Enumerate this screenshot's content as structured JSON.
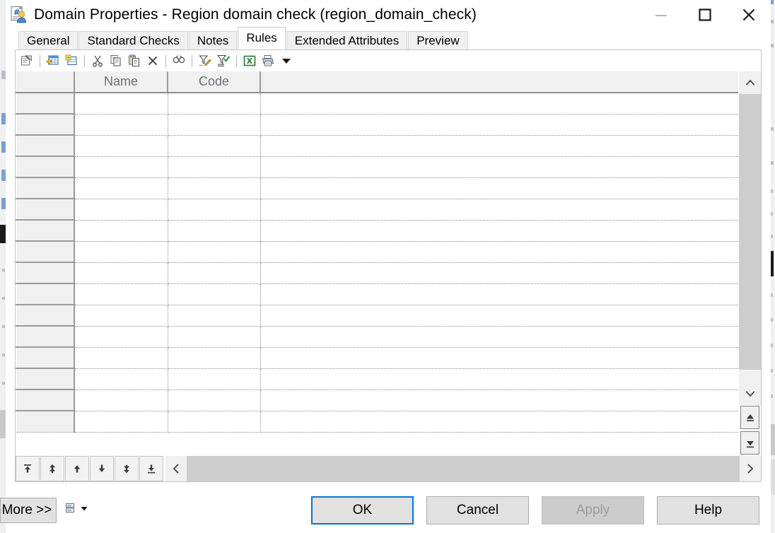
{
  "window": {
    "title": "Domain Properties - Region domain check (region_domain_check)",
    "icon": "domain-properties-icon",
    "controls": {
      "minimize": "minimize-icon",
      "maximize": "maximize-icon",
      "close": "close-icon"
    }
  },
  "tabs": [
    {
      "label": "General",
      "active": false
    },
    {
      "label": "Standard Checks",
      "active": false
    },
    {
      "label": "Notes",
      "active": false
    },
    {
      "label": "Rules",
      "active": true
    },
    {
      "label": "Extended Attributes",
      "active": false
    },
    {
      "label": "Preview",
      "active": false
    }
  ],
  "grid_toolbar": [
    {
      "name": "properties-icon",
      "tooltip": "Properties"
    },
    {
      "name": "separator",
      "tooltip": ""
    },
    {
      "name": "add-row-icon",
      "tooltip": "Add a Row"
    },
    {
      "name": "insert-row-icon",
      "tooltip": "Insert a Row"
    },
    {
      "name": "separator",
      "tooltip": ""
    },
    {
      "name": "cut-icon",
      "tooltip": "Cut"
    },
    {
      "name": "copy-icon",
      "tooltip": "Copy"
    },
    {
      "name": "paste-icon",
      "tooltip": "Paste"
    },
    {
      "name": "delete-icon",
      "tooltip": "Delete"
    },
    {
      "name": "separator",
      "tooltip": ""
    },
    {
      "name": "find-icon",
      "tooltip": "Find"
    },
    {
      "name": "separator",
      "tooltip": ""
    },
    {
      "name": "customize-filter-icon",
      "tooltip": "Customize Filter"
    },
    {
      "name": "apply-filter-icon",
      "tooltip": "Apply Filter"
    },
    {
      "name": "separator",
      "tooltip": ""
    },
    {
      "name": "excel-export-icon",
      "tooltip": "Export to Excel"
    },
    {
      "name": "print-icon",
      "tooltip": "Print"
    },
    {
      "name": "dropdown-arrow-icon",
      "tooltip": "More"
    }
  ],
  "grid": {
    "columns": [
      {
        "key": "sel",
        "label": ""
      },
      {
        "key": "name",
        "label": "Name"
      },
      {
        "key": "code",
        "label": "Code"
      },
      {
        "key": "rest",
        "label": ""
      }
    ],
    "rows": [
      {
        "sel": "",
        "name": "",
        "code": "",
        "rest": ""
      },
      {
        "sel": "",
        "name": "",
        "code": "",
        "rest": ""
      },
      {
        "sel": "",
        "name": "",
        "code": "",
        "rest": ""
      },
      {
        "sel": "",
        "name": "",
        "code": "",
        "rest": ""
      },
      {
        "sel": "",
        "name": "",
        "code": "",
        "rest": ""
      },
      {
        "sel": "",
        "name": "",
        "code": "",
        "rest": ""
      },
      {
        "sel": "",
        "name": "",
        "code": "",
        "rest": ""
      },
      {
        "sel": "",
        "name": "",
        "code": "",
        "rest": ""
      },
      {
        "sel": "",
        "name": "",
        "code": "",
        "rest": ""
      },
      {
        "sel": "",
        "name": "",
        "code": "",
        "rest": ""
      },
      {
        "sel": "",
        "name": "",
        "code": "",
        "rest": ""
      },
      {
        "sel": "",
        "name": "",
        "code": "",
        "rest": ""
      },
      {
        "sel": "",
        "name": "",
        "code": "",
        "rest": ""
      },
      {
        "sel": "",
        "name": "",
        "code": "",
        "rest": ""
      },
      {
        "sel": "",
        "name": "",
        "code": "",
        "rest": ""
      },
      {
        "sel": "",
        "name": "",
        "code": "",
        "rest": ""
      }
    ],
    "row_count": 16,
    "empty": true
  },
  "vertical_scrollbar": {
    "up_button": "scroll-up-icon",
    "down_button": "scroll-down-icon",
    "page_top_button": "move-to-top-icon",
    "page_bottom_button": "move-to-bottom-icon"
  },
  "horizontal_scrollbar": {
    "left_button": "scroll-left-icon",
    "right_button": "scroll-right-icon"
  },
  "row_move_buttons": [
    {
      "name": "move-first-button",
      "icon": "arrow-to-top-icon"
    },
    {
      "name": "move-page-up-button",
      "icon": "double-arrow-up-icon"
    },
    {
      "name": "move-up-button",
      "icon": "arrow-up-icon"
    },
    {
      "name": "move-down-button",
      "icon": "arrow-down-icon"
    },
    {
      "name": "move-page-down-button",
      "icon": "double-arrow-down-icon"
    },
    {
      "name": "move-last-button",
      "icon": "arrow-to-bottom-icon"
    }
  ],
  "footer": {
    "more_label": "More >>",
    "menu_icon": "list-menu-icon",
    "menu_arrow_icon": "dropdown-arrow-icon",
    "buttons": [
      {
        "label": "OK",
        "state": "default"
      },
      {
        "label": "Cancel",
        "state": "normal"
      },
      {
        "label": "Apply",
        "state": "disabled"
      },
      {
        "label": "Help",
        "state": "normal"
      }
    ]
  },
  "colors": {
    "accent": "#0078d7",
    "window_bg": "#ffffff",
    "control_bg": "#f0f0f0",
    "button_bg": "#e1e1e1",
    "disabled_text": "#9d9d9d",
    "header_text": "#6b7177",
    "grid_line": "#8a8a8a"
  }
}
